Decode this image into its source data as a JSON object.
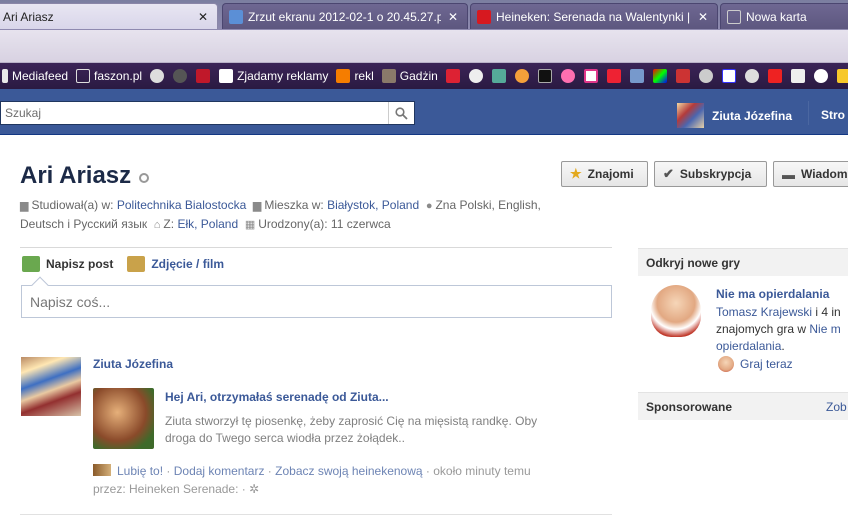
{
  "browser": {
    "tabs": [
      {
        "title": "Ari Ariasz",
        "active": true,
        "close": "✕"
      },
      {
        "title": "Zrzut ekranu 2012-02-1 o 20.45.27.png",
        "active": false,
        "close": "✕"
      },
      {
        "title": "Heineken: Serenada na Walentynki | K...",
        "active": false,
        "close": "✕"
      },
      {
        "title": "Nowa karta",
        "active": false,
        "close": ""
      }
    ],
    "bookmarks": {
      "labeled": [
        {
          "label": "Mediafeed"
        },
        {
          "label": "faszon.pl"
        },
        {
          "label": "Zjadamy reklamy"
        },
        {
          "label": "rekl"
        },
        {
          "label": "Gadżin"
        }
      ],
      "icon_count": 25
    }
  },
  "facebook": {
    "search": {
      "placeholder": "Szukaj",
      "value": ""
    },
    "user": {
      "name": "Ziuta Józefina"
    },
    "nav_link": "Stro"
  },
  "profile": {
    "name": "Ari Ariasz",
    "buttons": {
      "friends": "Znajomi",
      "subscribe": "Subskrypcja",
      "message": "Wiadom"
    },
    "info": {
      "studied_label": "Studiował(a) w:",
      "studied_value": "Politechnika Bialostocka",
      "lives_label": "Mieszka w:",
      "lives_value": "Białystok, Poland",
      "knows_label": "Zna Polski, English,",
      "knows_line2": "Deutsch i Русский язык",
      "from_label": "Z:",
      "from_value": "Ełk, Poland",
      "born_label": "Urodzony(a): 11 czerwca"
    }
  },
  "composer": {
    "tab_post": "Napisz post",
    "tab_photo": "Zdjęcie / film",
    "placeholder": "Napisz coś..."
  },
  "story": {
    "author": "Ziuta Józefina",
    "title": "Hej Ari, otrzymałaś serenadę od Ziuta...",
    "description": "Ziuta stworzył tę piosenkę, żeby zaprosić Cię na mięsistą randkę. Oby droga do Twego serca wiodła przez żołądek..",
    "like": "Lubię to!",
    "comment": "Dodaj komentarz",
    "view": "Zobacz swoją heinekenową",
    "time": "około minuty temu",
    "via": "przez: Heineken Serenade:",
    "sep": "·"
  },
  "sidebar": {
    "games_header": "Odkryj nowe gry",
    "game_title": "Nie ma opierdalania",
    "game_user": "Tomasz Krajewski",
    "game_text_1": "i 4 in",
    "game_text_2": "znajomych gra w",
    "game_link_2": "Nie m",
    "game_link_3": "opierdalania",
    "game_text_3": ".",
    "play": "Graj teraz",
    "sponsored_header": "Sponsorowane",
    "sponsored_link": "Zob"
  }
}
